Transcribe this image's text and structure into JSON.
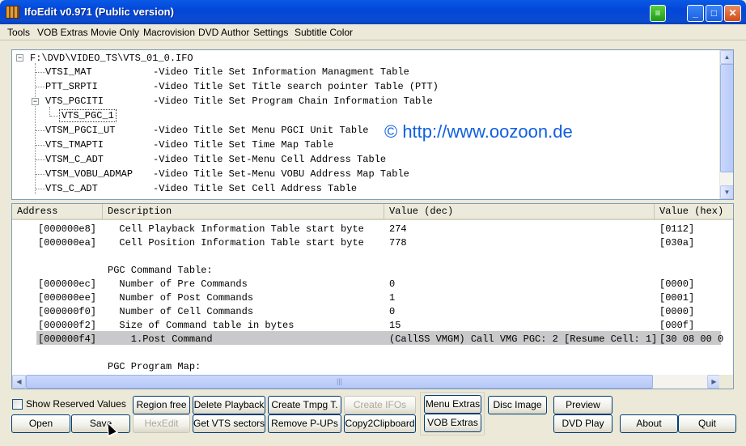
{
  "window": {
    "title": "IfoEdit v0.971 (Public version)",
    "controls": {
      "minimize": "_",
      "maximize": "□",
      "close": "✕"
    }
  },
  "menu": [
    "Tools",
    "VOB Extras",
    "Movie Only",
    "Macrovision",
    "DVD Author",
    "Settings",
    "Subtitle Color"
  ],
  "tree": {
    "root": "F:\\DVD\\VIDEO_TS\\VTS_01_0.IFO",
    "root_toggle": "−",
    "items": [
      {
        "name": "VTSI_MAT",
        "desc": "-Video Title Set Information Managment Table"
      },
      {
        "name": "PTT_SRPTI",
        "desc": "-Video Title Set Title search pointer Table (PTT)"
      },
      {
        "name": "VTS_PGCITI",
        "desc": "-Video Title Set Program Chain Information Table",
        "toggle": "−"
      },
      {
        "name": "VTS_PGC_1",
        "desc": "",
        "child": true,
        "selected": true
      },
      {
        "name": "VTSM_PGCI_UT",
        "desc": "-Video Title Set Menu PGCI Unit Table"
      },
      {
        "name": "VTS_TMAPTI",
        "desc": "-Video Title Set Time Map Table"
      },
      {
        "name": "VTSM_C_ADT",
        "desc": "-Video Title Set-Menu Cell Address Table"
      },
      {
        "name": "VTSM_VOBU_ADMAP",
        "desc": "-Video Title Set-Menu VOBU Address Map Table"
      },
      {
        "name": "VTS_C_ADT",
        "desc": "-Video Title Set Cell Address Table"
      }
    ],
    "watermark": "© http://www.oozoon.de"
  },
  "table": {
    "columns": [
      "Address",
      "Description",
      "Value (dec)",
      "Value (hex)"
    ],
    "rows": [
      {
        "address": "[000000e8]",
        "description": "  Cell Playback Information Table start byte",
        "dec": "274",
        "hex": "[0112]"
      },
      {
        "address": "[000000ea]",
        "description": "  Cell Position Information Table start byte",
        "dec": "778",
        "hex": "[030a]"
      },
      {
        "address": "",
        "description": "",
        "dec": "",
        "hex": ""
      },
      {
        "address": "",
        "description": "PGC Command Table:",
        "dec": "",
        "hex": ""
      },
      {
        "address": "[000000ec]",
        "description": "  Number of Pre Commands",
        "dec": "0",
        "hex": "[0000]"
      },
      {
        "address": "[000000ee]",
        "description": "  Number of Post Commands",
        "dec": "1",
        "hex": "[0001]"
      },
      {
        "address": "[000000f0]",
        "description": "  Number of Cell Commands",
        "dec": "0",
        "hex": "[0000]"
      },
      {
        "address": "[000000f2]",
        "description": "  Size of Command table in bytes",
        "dec": "15",
        "hex": "[000f]"
      },
      {
        "address": "[000000f4]",
        "description": "    1.Post Command",
        "dec": "(CallSS VMGM) Call VMG PGC: 2 [Resume Cell: 1]",
        "hex": "[30 08 00 0",
        "selected": true
      },
      {
        "address": "",
        "description": "",
        "dec": "",
        "hex": ""
      },
      {
        "address": "",
        "description": "PGC Program Map:",
        "dec": "",
        "hex": ""
      }
    ]
  },
  "controls": {
    "show_reserved": "Show Reserved Values",
    "buttons": {
      "open": "Open",
      "save": "Save",
      "region_free": "Region free",
      "hexedit": "HexEdit",
      "delete_playback": "Delete Playback",
      "get_vts_sectors": "Get VTS sectors",
      "create_tmpg": "Create Tmpg T.",
      "remove_pups": "Remove P-UPs",
      "create_ifos": "Create IFOs",
      "copy_clipboard": "Copy2Clipboard",
      "menu_extras": "Menu Extras",
      "vob_extras": "VOB Extras",
      "disc_image": "Disc Image",
      "preview": "Preview",
      "dvd_play": "DVD Play",
      "about": "About",
      "quit": "Quit"
    }
  },
  "colors": {
    "titlebar": "#0346d9",
    "watermark": "#1060e0",
    "selection": "#c9c9cb"
  }
}
